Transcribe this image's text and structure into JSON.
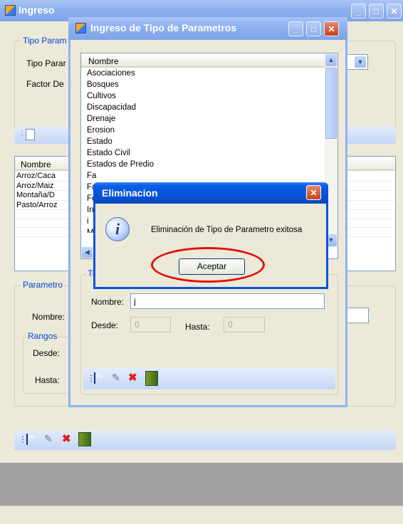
{
  "main_window": {
    "title": "Ingreso",
    "group_tipo": "Tipo Param",
    "label_tipo": "Tipo Parar",
    "label_factor": "Factor De",
    "list_header": "Nombre",
    "list_rows": [
      "Arroz/Caca",
      "Arroz/Maiz",
      "Montaña/D",
      "Pasto/Arroz"
    ],
    "group_parametro": "Parametro",
    "label_nombre": "Nombre:",
    "group_rangos": "Rangos",
    "label_desde": "Desde:",
    "label_hasta": "Hasta:"
  },
  "dialog": {
    "title": "Ingreso de Tipo de Parametros",
    "list_header": "Nombre",
    "list_items": [
      "Asociaciones",
      "Bosques",
      "Cultivos",
      "Discapacidad",
      "Drenaje",
      "Erosion",
      "Estado",
      "Estado Civil",
      "Estados de Predio",
      "Fa",
      "Fa",
      "Fo",
      "In",
      "i",
      "M"
    ],
    "group_label": "Ti",
    "label_nombre": "Nombre:",
    "nombre_value": "j",
    "label_desde": "Desde:",
    "desde_value": "0",
    "label_hasta": "Hasta:",
    "hasta_value": "0"
  },
  "message_box": {
    "title": "Eliminacion",
    "message": "Eliminación de Tipo de Parametro exitosa",
    "ok_label": "Aceptar",
    "highlight_color": "#e01010"
  },
  "colors": {
    "titlebar_active": "#0854d6",
    "group_label": "#0046d5",
    "toolstrip": "#c4d7f7",
    "window_bg": "#ece9d8"
  }
}
